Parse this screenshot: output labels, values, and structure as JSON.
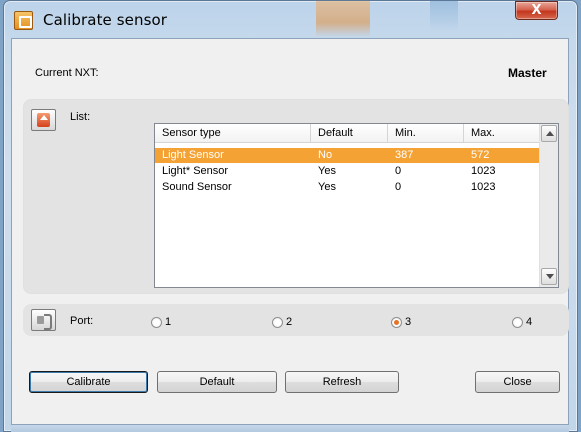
{
  "window": {
    "title": "Calibrate sensor",
    "close_glyph": "X"
  },
  "current_nxt": {
    "label": "Current NXT:",
    "value": "Master"
  },
  "list": {
    "label": "List:",
    "icon": "upload-arrow-icon",
    "columns": [
      "Sensor type",
      "Default",
      "Min.",
      "Max."
    ],
    "rows": [
      {
        "type": "Light Sensor",
        "default": "No",
        "min": "387",
        "max": "572",
        "selected": true
      },
      {
        "type": "Light* Sensor",
        "default": "Yes",
        "min": "0",
        "max": "1023",
        "selected": false
      },
      {
        "type": "Sound Sensor",
        "default": "Yes",
        "min": "0",
        "max": "1023",
        "selected": false
      }
    ]
  },
  "port": {
    "label": "Port:",
    "icon": "port-plug-icon",
    "options": [
      "1",
      "2",
      "3",
      "4"
    ],
    "selected": "3"
  },
  "buttons": {
    "calibrate": "Calibrate",
    "default": "Default",
    "refresh": "Refresh",
    "close": "Close"
  },
  "colors": {
    "selection": "#f4a234",
    "radio_accent": "#e2742a",
    "close_button": "#c2351d"
  }
}
